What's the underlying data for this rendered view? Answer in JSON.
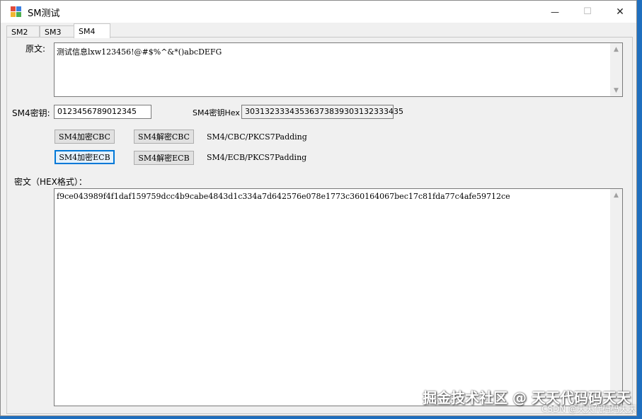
{
  "window": {
    "title": "SM测试",
    "minimize": "—",
    "maximize": "☐",
    "close": "✕"
  },
  "tabs": [
    {
      "label": "SM2"
    },
    {
      "label": "SM3"
    },
    {
      "label": "SM4"
    }
  ],
  "plaintext": {
    "label": "原文:",
    "value": "测试信息lxw123456!@#$%^&*()abcDEFG"
  },
  "key": {
    "label": "SM4密钥:",
    "value": "0123456789012345",
    "hex_label": "SM4密钥Hex",
    "hex_value": "30313233343536373839303132333435"
  },
  "cbc": {
    "encrypt_label": "SM4加密CBC",
    "decrypt_label": "SM4解密CBC",
    "mode_text": "SM4/CBC/PKCS7Padding"
  },
  "ecb": {
    "encrypt_label": "SM4加密ECB",
    "decrypt_label": "SM4解密ECB",
    "mode_text": "SM4/ECB/PKCS7Padding"
  },
  "ciphertext": {
    "label": "密文（HEX格式）：",
    "value": "f9ce043989f4f1daf159759dcc4b9cabe4843d1c334a7d642576e078e1773c360164067bec17c81fda77c4afe59712ce"
  },
  "watermark": {
    "main": "掘金技术社区 @ 天天代码码天天",
    "sub": "CSDN @天天代码码天天"
  },
  "colors": {
    "accent": "#0078d7",
    "desktop": "#1f6fbf"
  }
}
